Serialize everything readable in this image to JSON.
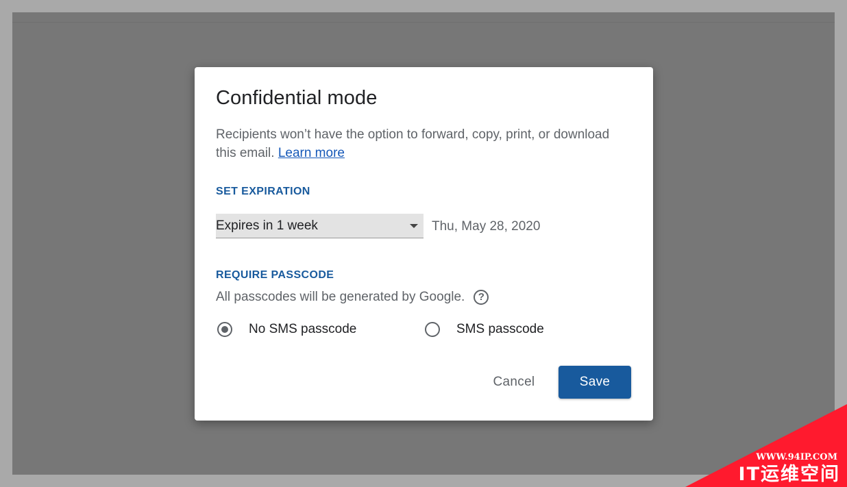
{
  "dialog": {
    "title": "Confidential mode",
    "description": "Recipients won’t have the option to forward, copy, print, or download this email.",
    "learn_more": "Learn more",
    "expiration": {
      "label": "SET EXPIRATION",
      "selected": "Expires in 1 week",
      "date": "Thu, May 28, 2020"
    },
    "passcode": {
      "label": "REQUIRE PASSCODE",
      "note": "All passcodes will be generated by Google.",
      "help_symbol": "?",
      "options": [
        {
          "label": "No SMS passcode",
          "checked": true
        },
        {
          "label": "SMS passcode",
          "checked": false
        }
      ]
    },
    "cancel_label": "Cancel",
    "save_label": "Save"
  },
  "watermark": {
    "url": "WWW.94IP.COM",
    "name": "IT运维空间"
  },
  "colors": {
    "accent": "#185a9d",
    "link": "#1558b8",
    "backdrop": "#777777",
    "watermark": "#ff1a2e"
  }
}
